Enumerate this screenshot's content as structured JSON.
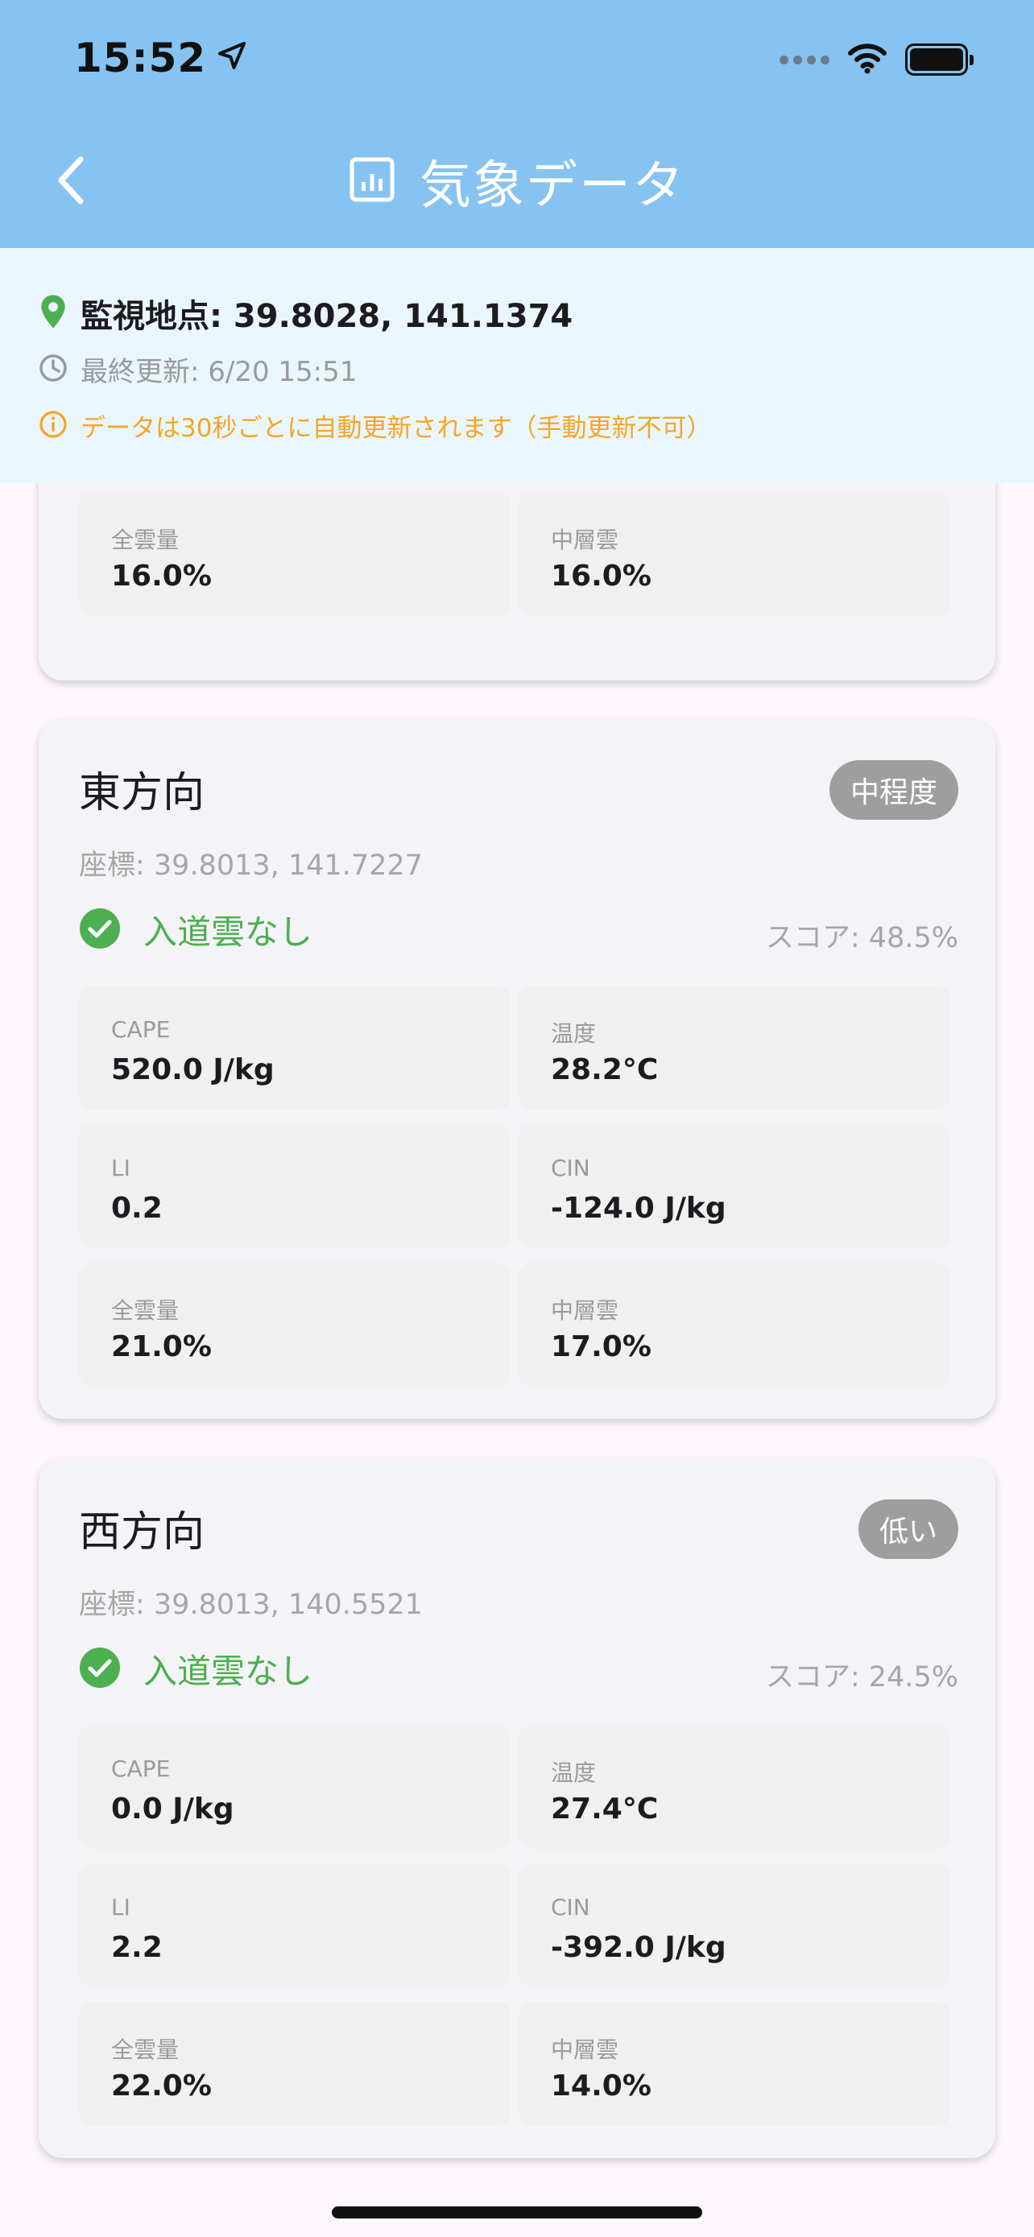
{
  "status_bar": {
    "time": "15:52"
  },
  "header": {
    "title": "気象データ"
  },
  "info": {
    "location": "監視地点: 39.8028, 141.1374",
    "last_update": "最終更新: 6/20 15:51",
    "note": "データは30秒ごとに自動更新されます（手動更新不可）"
  },
  "cards": [
    {
      "metrics": [
        {
          "label": "全雲量",
          "value": "16.0%"
        },
        {
          "label": "中層雲",
          "value": "16.0%"
        }
      ]
    },
    {
      "title": "東方向",
      "badge": "中程度",
      "coords": "座標: 39.8013, 141.7227",
      "status": "入道雲なし",
      "score": "スコア: 48.5%",
      "metrics": [
        {
          "label": "CAPE",
          "value": "520.0 J/kg"
        },
        {
          "label": "温度",
          "value": "28.2°C"
        },
        {
          "label": "LI",
          "value": "0.2"
        },
        {
          "label": "CIN",
          "value": "-124.0 J/kg"
        },
        {
          "label": "全雲量",
          "value": "21.0%"
        },
        {
          "label": "中層雲",
          "value": "17.0%"
        }
      ]
    },
    {
      "title": "西方向",
      "badge": "低い",
      "coords": "座標: 39.8013, 140.5521",
      "status": "入道雲なし",
      "score": "スコア: 24.5%",
      "metrics": [
        {
          "label": "CAPE",
          "value": "0.0 J/kg"
        },
        {
          "label": "温度",
          "value": "27.4°C"
        },
        {
          "label": "LI",
          "value": "2.2"
        },
        {
          "label": "CIN",
          "value": "-392.0 J/kg"
        },
        {
          "label": "全雲量",
          "value": "22.0%"
        },
        {
          "label": "中層雲",
          "value": "14.0%"
        }
      ]
    }
  ],
  "colors": {
    "app_bar": "#86c3f1",
    "info_bg": "#eaf6fd",
    "status_ok": "#4caf50",
    "note": "#f5a623",
    "badge": "#9e9e9e"
  }
}
